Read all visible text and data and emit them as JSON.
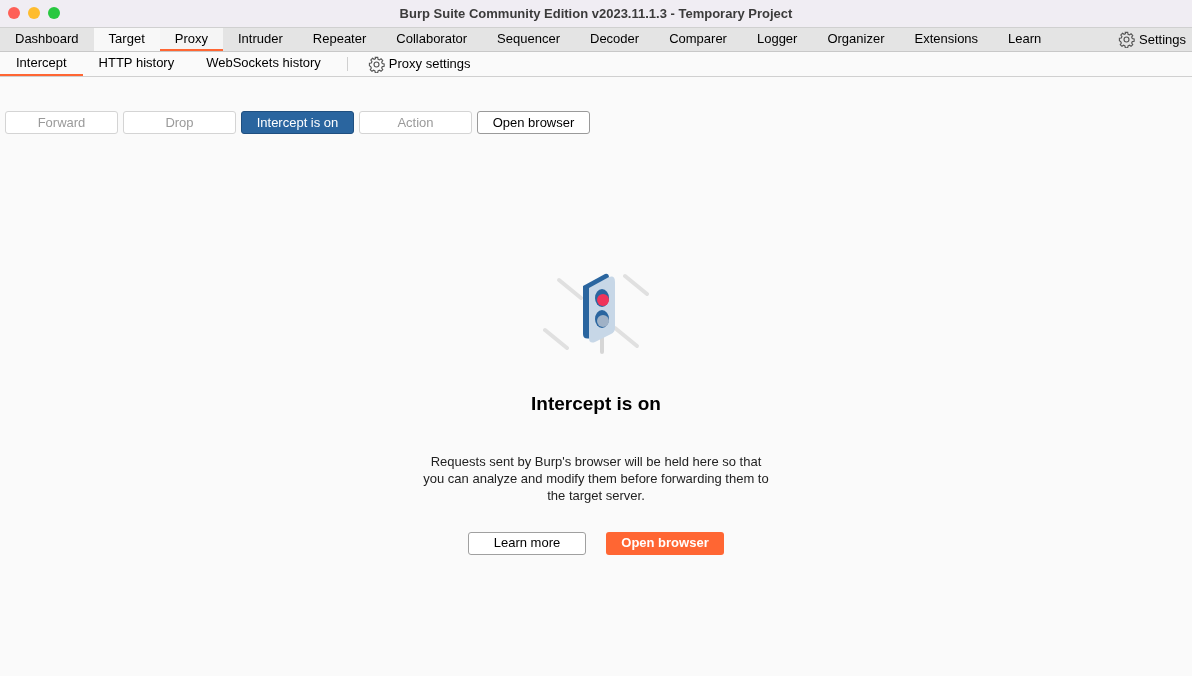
{
  "window": {
    "title": "Burp Suite Community Edition v2023.11.1.3 - Temporary Project"
  },
  "tabs": [
    {
      "label": "Dashboard",
      "selected": false,
      "hovered": false
    },
    {
      "label": "Target",
      "selected": false,
      "hovered": true
    },
    {
      "label": "Proxy",
      "selected": true,
      "hovered": false
    },
    {
      "label": "Intruder",
      "selected": false,
      "hovered": false
    },
    {
      "label": "Repeater",
      "selected": false,
      "hovered": false
    },
    {
      "label": "Collaborator",
      "selected": false,
      "hovered": false
    },
    {
      "label": "Sequencer",
      "selected": false,
      "hovered": false
    },
    {
      "label": "Decoder",
      "selected": false,
      "hovered": false
    },
    {
      "label": "Comparer",
      "selected": false,
      "hovered": false
    },
    {
      "label": "Logger",
      "selected": false,
      "hovered": false
    },
    {
      "label": "Organizer",
      "selected": false,
      "hovered": false
    },
    {
      "label": "Extensions",
      "selected": false,
      "hovered": false
    },
    {
      "label": "Learn",
      "selected": false,
      "hovered": false
    }
  ],
  "settings_button": {
    "label": "Settings"
  },
  "subtabs": [
    {
      "label": "Intercept",
      "selected": true
    },
    {
      "label": "HTTP history",
      "selected": false
    },
    {
      "label": "WebSockets history",
      "selected": false
    }
  ],
  "proxy_settings_button": {
    "label": "Proxy settings"
  },
  "toolbar": [
    {
      "label": "Forward",
      "disabled": true,
      "active": false
    },
    {
      "label": "Drop",
      "disabled": true,
      "active": false
    },
    {
      "label": "Intercept is on",
      "disabled": false,
      "active": true
    },
    {
      "label": "Action",
      "disabled": true,
      "active": false
    },
    {
      "label": "Open browser",
      "disabled": false,
      "active": false
    }
  ],
  "empty_state": {
    "heading": "Intercept is on",
    "text": "Requests sent by Burp's browser will be held here so that you can analyze and modify them before forwarding them to the target server.",
    "buttons": [
      {
        "label": "Learn more",
        "kind": "secondary"
      },
      {
        "label": "Open browser",
        "kind": "primary"
      }
    ]
  }
}
